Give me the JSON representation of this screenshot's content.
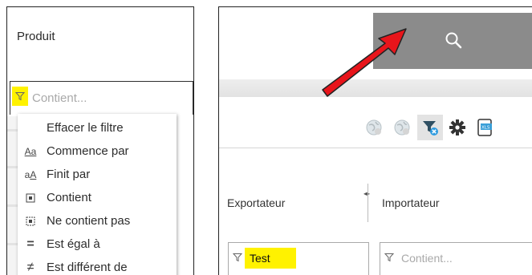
{
  "left_panel": {
    "column_title": "Produit",
    "filter_placeholder": "Contient...",
    "menu_items": [
      {
        "label": "Effacer le filtre",
        "icon": "none",
        "glyph": ""
      },
      {
        "label": "Commence par",
        "icon": "starts-with-icon",
        "glyph": "Aa"
      },
      {
        "label": "Finit par",
        "icon": "ends-with-icon",
        "glyph": "aA"
      },
      {
        "label": "Contient",
        "icon": "contains-icon",
        "glyph": "▣"
      },
      {
        "label": "Ne contient pas",
        "icon": "not-contains-icon",
        "glyph": "⬚"
      },
      {
        "label": "Est égal à",
        "icon": "equals-icon",
        "glyph": "="
      },
      {
        "label": "Est différent de",
        "icon": "not-equals-icon",
        "glyph": "≠"
      }
    ]
  },
  "right_panel": {
    "search_icon": "search-icon",
    "toolbar_icons": [
      "globe-disabled-icon",
      "globe-disabled-icon",
      "clear-filter-icon",
      "gear-icon",
      "export-xls-icon"
    ],
    "columns": {
      "exporter": {
        "header": "Exportateur",
        "filter_value": "Test"
      },
      "importer": {
        "header": "Importateur",
        "filter_placeholder": "Contient..."
      }
    }
  },
  "colors": {
    "highlight": "#fff200",
    "search_bar": "#8b8b8b",
    "arrow": "#e8151b"
  }
}
